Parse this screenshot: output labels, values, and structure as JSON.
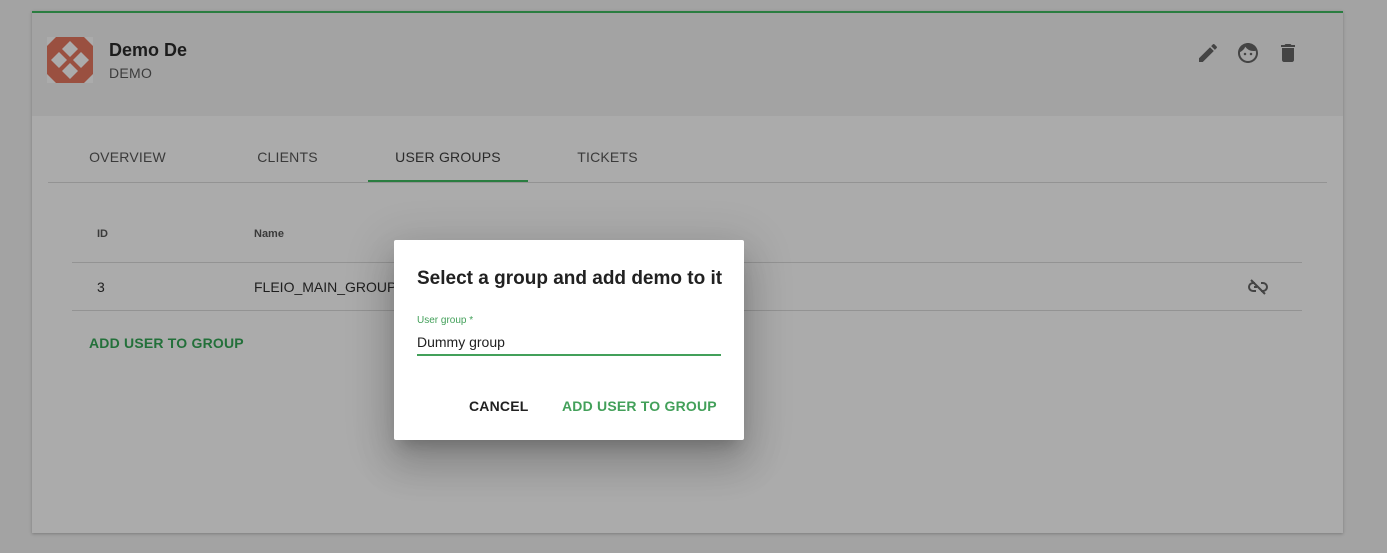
{
  "client": {
    "name": "Demo De",
    "code": "DEMO",
    "avatar_colors": {
      "bg": "#9a5040",
      "fg": "#ababab"
    }
  },
  "header_actions": [
    {
      "name": "edit-icon"
    },
    {
      "name": "face-icon"
    },
    {
      "name": "delete-icon"
    }
  ],
  "tabs": [
    {
      "label": "OVERVIEW",
      "active": false
    },
    {
      "label": "CLIENTS",
      "active": false
    },
    {
      "label": "USER GROUPS",
      "active": true
    },
    {
      "label": "TICKETS",
      "active": false
    }
  ],
  "table": {
    "headers": [
      "ID",
      "Name"
    ],
    "rows": [
      {
        "id": "3",
        "name": "FLEIO_MAIN_GROUP",
        "action_icon": "unlink-icon"
      }
    ]
  },
  "add_user_link": "ADD USER TO GROUP",
  "dialog": {
    "title": "Select a group and add demo to it",
    "field_label": "User group *",
    "field_value": "Dummy group",
    "cancel_label": "CANCEL",
    "confirm_label": "ADD USER TO GROUP"
  },
  "colors": {
    "accent": "#43a05a",
    "accent_dimmed": "#2a7d40",
    "overlay": "#a3a3a3"
  }
}
